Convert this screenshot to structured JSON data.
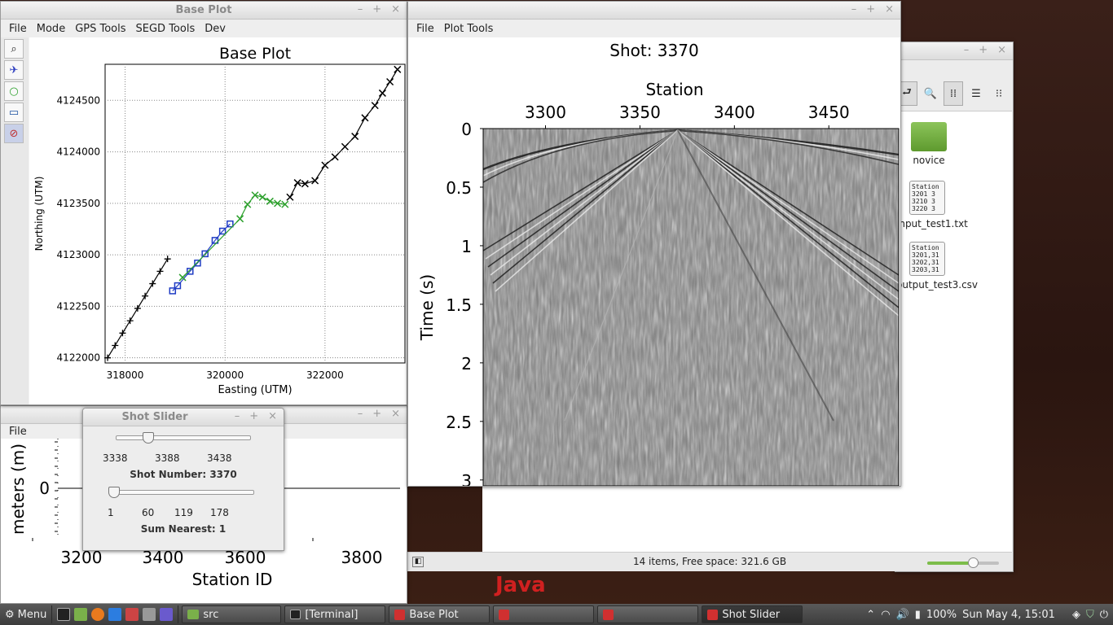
{
  "colors": {
    "accent": "#2ca02c",
    "blue": "#1f3cc4",
    "wallpaper": "#2c1a14"
  },
  "base_plot": {
    "window_title": "Base Plot",
    "menu": [
      "File",
      "Mode",
      "GPS Tools",
      "SEGD Tools",
      "Dev"
    ],
    "tools": [
      "zoom-icon",
      "airplane-icon",
      "circle-icon",
      "monitor-icon",
      "no-entry-icon"
    ]
  },
  "shot_window": {
    "menu": [
      "File",
      "Plot Tools"
    ]
  },
  "elevation_window": {
    "menu": [
      "File"
    ]
  },
  "shot_slider": {
    "window_title": "Shot Slider",
    "slider1_ticks": [
      "3338",
      "3388",
      "3438"
    ],
    "shot_label": "Shot Number: 3370",
    "shot_value": 3370,
    "slider2_ticks": [
      "1",
      "60",
      "119",
      "178"
    ],
    "sum_label": "Sum Nearest: 1",
    "sum_value": 1
  },
  "file_manager": {
    "items": [
      {
        "name": "novice",
        "icon": "folder-icon"
      },
      {
        "name": "input_test1.txt",
        "icon": "text-file-icon",
        "preview": [
          "Station",
          "3201  3",
          "3210  3",
          "3220  3"
        ]
      },
      {
        "name": "output_test3.csv",
        "icon": "text-file-icon",
        "preview": [
          "Station",
          "3201,31",
          "3202,31",
          "3203,31"
        ]
      }
    ],
    "status": "14 items, Free space: 321.6 GB",
    "zoom_fraction": 0.62
  },
  "java_label": "Java",
  "chart_data": [
    {
      "type": "scatter",
      "title": "Base Plot",
      "xlabel": "Easting (UTM)",
      "ylabel": "Northing (UTM)",
      "xlim": [
        317600,
        323600
      ],
      "ylim": [
        4121950,
        4124850
      ],
      "xticks": [
        318000,
        320000,
        322000
      ],
      "yticks": [
        4122000,
        4122500,
        4123000,
        4123500,
        4124000,
        4124500
      ],
      "grid": "dotted",
      "series": [
        {
          "marker": "plus",
          "color": "#000000",
          "x": [
            317650,
            317800,
            317950,
            318100,
            318250,
            318400,
            318550,
            318700,
            318850
          ],
          "y": [
            4122000,
            4122120,
            4122240,
            4122360,
            4122480,
            4122600,
            4122720,
            4122840,
            4122960
          ]
        },
        {
          "marker": "square",
          "color": "#1f3cc4",
          "x": [
            318950,
            319050,
            319300,
            319450,
            319600,
            319800,
            319950,
            320100
          ],
          "y": [
            4122650,
            4122700,
            4122840,
            4122920,
            4123010,
            4123140,
            4123230,
            4123300
          ]
        },
        {
          "marker": "x",
          "color": "#2ca02c",
          "x": [
            319150,
            320300,
            320450,
            320600,
            320750,
            320900,
            321050,
            321200
          ],
          "y": [
            4122780,
            4123350,
            4123490,
            4123580,
            4123560,
            4123520,
            4123500,
            4123490
          ]
        },
        {
          "marker": "x",
          "color": "#000000",
          "x": [
            321300,
            321450,
            321600,
            321800,
            322000,
            322200,
            322400,
            322600,
            322800,
            323000,
            323150,
            323300,
            323450
          ],
          "y": [
            4123560,
            4123700,
            4123690,
            4123720,
            4123870,
            4123950,
            4124050,
            4124150,
            4124330,
            4124450,
            4124570,
            4124680,
            4124800
          ]
        }
      ]
    },
    {
      "type": "heatmap",
      "title": "Shot: 3370",
      "xlabel": "Station",
      "ylabel": "Time (s)",
      "xlim": [
        3267,
        3487
      ],
      "ylim": [
        0,
        3.05
      ],
      "xticks": [
        "3300",
        "3350",
        "3400",
        "3450"
      ],
      "yticks": [
        "0",
        "0.5",
        "1",
        "1.5",
        "2",
        "2.5",
        "3"
      ],
      "colormap": "gray seismic"
    },
    {
      "type": "line",
      "xlabel": "Station ID",
      "ylabel": "meters (m)",
      "xticks": [
        "3200",
        "3400",
        "3600",
        "3800"
      ],
      "yticks": [
        "0"
      ]
    }
  ],
  "taskbar": {
    "menu_label": "Menu",
    "tasks": [
      "src",
      "[Terminal]",
      "Base Plot",
      "",
      "",
      "Shot Slider"
    ],
    "battery": "100%",
    "clock": "Sun May  4, 15:01"
  }
}
